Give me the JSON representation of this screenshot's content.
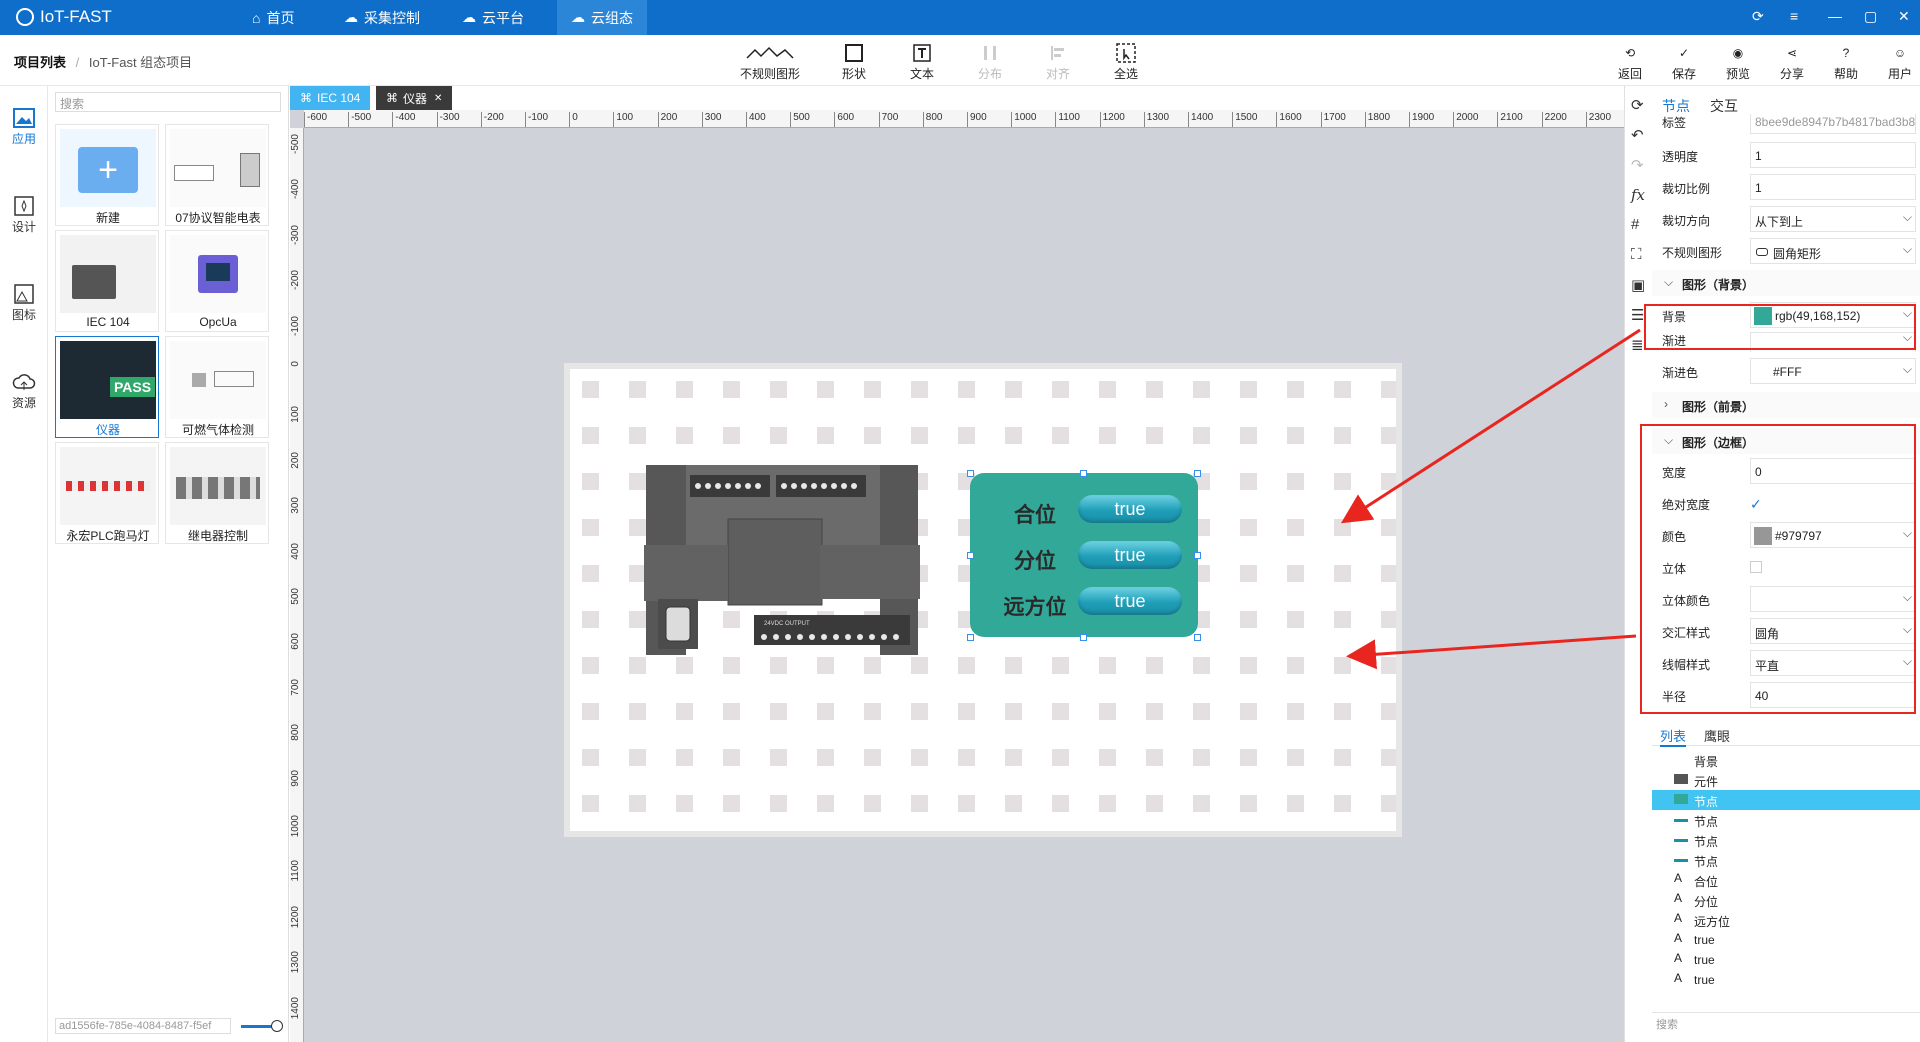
{
  "app": {
    "title": "IoT-FAST"
  },
  "nav": {
    "items": [
      {
        "label": "首页",
        "icon": "home-icon"
      },
      {
        "label": "采集控制",
        "icon": "cloud-control-icon"
      },
      {
        "label": "云平台",
        "icon": "cloud-platform-icon"
      },
      {
        "label": "云组态",
        "icon": "cloud-config-icon",
        "active": true
      }
    ]
  },
  "window_controls": [
    "refresh-icon",
    "menu-icon",
    "minimize-icon",
    "maximize-icon",
    "close-icon"
  ],
  "breadcrumb": {
    "root": "项目列表",
    "separator": "/",
    "current": "IoT-Fast 组态项目"
  },
  "toolbar": {
    "center": [
      {
        "label": "不规则图形",
        "icon": "irregular-shape-icon"
      },
      {
        "label": "形状",
        "icon": "shape-icon"
      },
      {
        "label": "文本",
        "icon": "text-icon"
      },
      {
        "label": "分布",
        "icon": "distribute-icon",
        "disabled": true
      },
      {
        "label": "对齐",
        "icon": "align-icon",
        "disabled": true
      },
      {
        "label": "全选",
        "icon": "select-all-icon"
      }
    ],
    "right": [
      {
        "label": "返回",
        "icon": "back-icon"
      },
      {
        "label": "保存",
        "icon": "save-icon"
      },
      {
        "label": "预览",
        "icon": "preview-icon"
      },
      {
        "label": "分享",
        "icon": "share-icon"
      },
      {
        "label": "帮助",
        "icon": "help-icon"
      },
      {
        "label": "用户",
        "icon": "user-icon"
      }
    ]
  },
  "left_nav": [
    {
      "label": "应用",
      "icon": "app-image-icon",
      "active": true
    },
    {
      "label": "设计",
      "icon": "design-icon"
    },
    {
      "label": "图标",
      "icon": "icon-library-icon"
    },
    {
      "label": "资源",
      "icon": "resource-cloud-icon"
    }
  ],
  "library": {
    "search_placeholder": "搜索",
    "items": [
      {
        "label": "新建"
      },
      {
        "label": "07协议智能电表"
      },
      {
        "label": "IEC 104"
      },
      {
        "label": "OpcUa"
      },
      {
        "label": "仪器",
        "selected": true,
        "badge": "PASS"
      },
      {
        "label": "可燃气体检测"
      },
      {
        "label": "永宏PLC跑马灯"
      },
      {
        "label": "继电器控制"
      }
    ],
    "footer_id": "ad1556fe-785e-4084-8487-f5ef"
  },
  "tabs": [
    {
      "label": "IEC 104",
      "active": true
    },
    {
      "label": "仪器"
    }
  ],
  "ruler": {
    "x": [
      "-600",
      "-500",
      "-400",
      "-300",
      "-200",
      "-100",
      "0",
      "100",
      "200",
      "300",
      "400",
      "500",
      "600",
      "700",
      "800",
      "900",
      "1000",
      "1100",
      "1200",
      "1300",
      "1400",
      "1500",
      "1600",
      "1700",
      "1800",
      "1900",
      "2000",
      "2100",
      "2200",
      "2300"
    ],
    "y": [
      "-500",
      "-400",
      "-300",
      "-200",
      "-100",
      "0",
      "100",
      "200",
      "300",
      "400",
      "500",
      "600",
      "700",
      "800",
      "900",
      "1000",
      "1100",
      "1200",
      "1300",
      "1400"
    ]
  },
  "canvas": {
    "panel": {
      "background": "#31a898",
      "rows": [
        {
          "label": "合位",
          "value": "true"
        },
        {
          "label": "分位",
          "value": "true"
        },
        {
          "label": "远方位",
          "value": "true"
        }
      ]
    },
    "plc": {
      "terminal_text": "24VDC OUTPUT"
    }
  },
  "side_tools": [
    "rotate-icon",
    "undo-icon",
    "redo-icon",
    "fx-icon",
    "grid-icon",
    "fit-icon",
    "screenshot-icon",
    "list-icon",
    "layers-icon"
  ],
  "props": {
    "tabs": [
      {
        "label": "节点",
        "active": true
      },
      {
        "label": "交互"
      }
    ],
    "top_rows": [
      {
        "key": "标签",
        "value": "8bee9de8947b7b4817bad3b8"
      },
      {
        "key": "透明度",
        "value": "1"
      },
      {
        "key": "裁切比例",
        "value": "1"
      },
      {
        "key": "裁切方向",
        "value": "从下到上",
        "dropdown": true
      },
      {
        "key": "不规则图形",
        "value": "圆角矩形",
        "dropdown": true
      }
    ],
    "section_bg": {
      "title": "图形（背景）"
    },
    "bg_rows": [
      {
        "key": "背景",
        "value": "rgb(49,168,152)",
        "swatch": "#31a898",
        "dropdown": true
      },
      {
        "key": "渐进",
        "value": "",
        "dropdown": true
      },
      {
        "key": "渐进色",
        "value": "#FFF",
        "dropdown": true
      }
    ],
    "section_fg": {
      "title": "图形（前景）"
    },
    "section_border": {
      "title": "图形（边框）"
    },
    "border_rows": [
      {
        "key": "宽度",
        "value": "0"
      },
      {
        "key": "绝对宽度",
        "value": "",
        "check": true
      },
      {
        "key": "颜色",
        "value": "#979797",
        "swatch": "#979797",
        "dropdown": true
      },
      {
        "key": "立体",
        "value": "",
        "check": false
      },
      {
        "key": "立体颜色",
        "value": "",
        "dropdown": true
      },
      {
        "key": "交汇样式",
        "value": "圆角",
        "dropdown": true
      },
      {
        "key": "线帽样式",
        "value": "平直",
        "dropdown": true
      },
      {
        "key": "半径",
        "value": "40"
      }
    ],
    "list_tabs": [
      {
        "label": "列表",
        "active": true
      },
      {
        "label": "鹰眼"
      }
    ],
    "layers": [
      {
        "label": "背景",
        "icon": "none"
      },
      {
        "label": "元件",
        "icon": "image"
      },
      {
        "label": "节点",
        "icon": "rect",
        "selected": true
      },
      {
        "label": "节点",
        "icon": "line"
      },
      {
        "label": "节点",
        "icon": "line"
      },
      {
        "label": "节点",
        "icon": "line"
      },
      {
        "label": "合位",
        "icon": "text"
      },
      {
        "label": "分位",
        "icon": "text"
      },
      {
        "label": "远方位",
        "icon": "text"
      },
      {
        "label": "true",
        "icon": "text"
      },
      {
        "label": "true",
        "icon": "text"
      },
      {
        "label": "true",
        "icon": "text"
      }
    ],
    "layer_search": "搜索"
  }
}
